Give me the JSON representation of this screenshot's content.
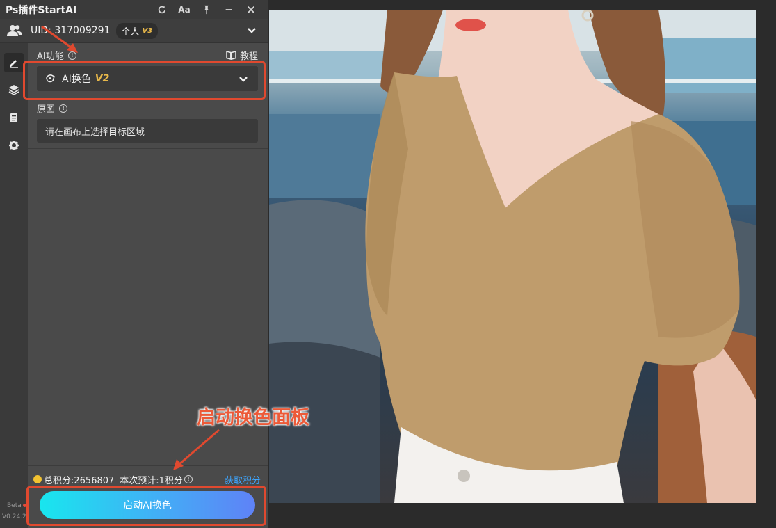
{
  "panel": {
    "title": "Ps插件StartAI",
    "titlebar_icons": [
      "refresh-icon",
      "font-size-icon",
      "pin-icon",
      "minimize-icon",
      "close-icon"
    ],
    "font_label": "Aa"
  },
  "user": {
    "uid_label": "UID: 317009291",
    "plan": "个人",
    "plan_level": "V3"
  },
  "sidenav": {
    "items": [
      "edit-icon",
      "layers-icon",
      "clipboard-icon",
      "gear-icon"
    ],
    "beta_label": "Beta",
    "version": "V0.24.2"
  },
  "ai_function": {
    "label": "AI功能",
    "tutorial_label": "教程",
    "selected": "AI换色",
    "selected_version": "V2"
  },
  "original_image": {
    "label": "原图",
    "placeholder_text": "请在画布上选择目标区域"
  },
  "points": {
    "total_label": "总积分:2656807",
    "estimate_label": "本次预计:1积分",
    "get_points_label": "获取积分"
  },
  "start_button": {
    "label": "启动AI换色"
  },
  "annotation": {
    "callout_text": "启动换色面板"
  },
  "colors": {
    "accent_gold": "#e8b84a",
    "link_blue": "#3ea6ff",
    "annotation_red": "#e0492f",
    "button_gradient_start": "#18e6ee",
    "button_gradient_end": "#5f82f7"
  }
}
